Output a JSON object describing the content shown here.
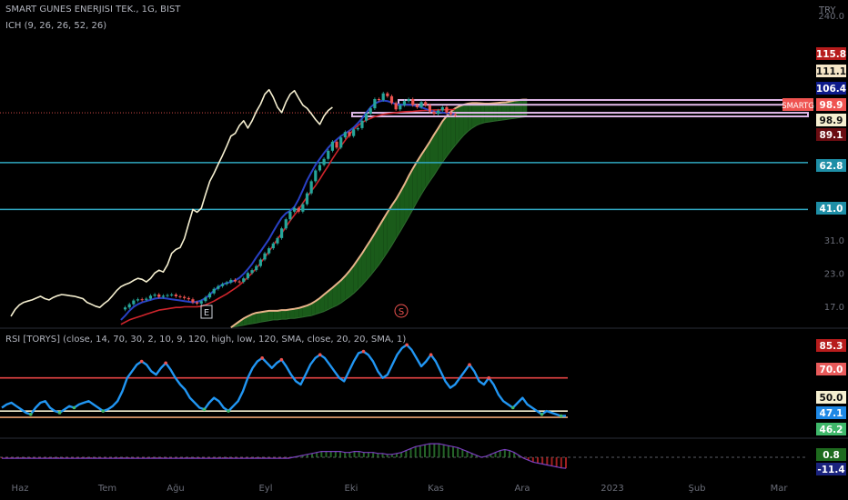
{
  "header": {
    "symbol_line": "SMART GUNES ENERJISI TEK., 1G, BIST",
    "indicator_line": "ICH (9, 26, 26, 52, 26)",
    "currency": "TRY"
  },
  "rsi_header": "RSI [TORYS] (close, 14, 70, 30, 2, 10, 9, 120, high, low, 120, SMA, close, 20, 20, SMA, 1)",
  "colors": {
    "background": "#000000",
    "price_line": "#f5efd0",
    "tenkan": "#2941c6",
    "kijun": "#d0252c",
    "senkou_a": "#e8b48a",
    "cloud_bull": "#1e6b1e",
    "horizontal_line": "#2fa7c0",
    "rsi_line": "#2196f3",
    "rsi_upper": "#e84545",
    "rsi_mid": "#f5efd0",
    "rsi_lower": "#e8a070",
    "candle_up": "#26a69a",
    "candle_down": "#ef5350"
  },
  "chart_data": [
    {
      "type": "line",
      "title": "SMART GUNES ENERJISI TEK., 1G, BIST",
      "log_scale": true,
      "x_labels": [
        "Haz",
        "Tem",
        "Ağu",
        "Eyl",
        "Eki",
        "Kas",
        "Ara",
        "2023",
        "Şub",
        "Mar"
      ],
      "y_ticks": [
        240.0,
        17.0,
        23.0,
        31.0
      ],
      "y_tick_labels": [
        "240.0",
        "17.0",
        "23.0",
        "31.0"
      ],
      "ylim": [
        14.5,
        250
      ],
      "horizontal_levels": [
        62.8,
        41.0
      ],
      "zones": [
        {
          "low": 106.4,
          "high": 111.1
        },
        {
          "low": 96.5,
          "high": 98.9
        }
      ],
      "price_labels": [
        {
          "text": "115.8",
          "value": 115.8,
          "color": "#b71c1c"
        },
        {
          "text": "111.1",
          "value": 111.1,
          "color": "#f5e6c8"
        },
        {
          "text": "106.4",
          "value": 106.4,
          "color": "#0d1a8a"
        },
        {
          "text": "98.9",
          "value": 98.9,
          "color": "#ef5350",
          "prefix": "SMARTG"
        },
        {
          "text": "98.9",
          "value": 96.0,
          "color": "#f5efd0"
        },
        {
          "text": "89.1",
          "value": 89.1,
          "color": "#6a0d12"
        },
        {
          "text": "62.8",
          "value": 62.8,
          "color": "#1e8ea6"
        },
        {
          "text": "41.0",
          "value": 41.0,
          "color": "#1e8ea6"
        }
      ],
      "markers": [
        "E",
        "S"
      ],
      "days": 130,
      "series": [
        {
          "role": "lagging",
          "values": [
            15.5,
            16.5,
            17.2,
            17.6,
            17.8,
            18.0,
            18.3,
            18.6,
            18.2,
            18.0,
            18.4,
            18.7,
            18.9,
            18.8,
            18.7,
            18.6,
            18.4,
            18.2,
            17.6,
            17.3,
            17.0,
            16.8,
            17.4,
            17.9,
            18.7,
            19.6,
            20.3,
            20.7,
            21.0,
            21.5,
            21.9,
            21.7,
            21.2,
            21.9,
            23.0,
            23.6,
            23.2,
            24.8,
            27.5,
            28.5,
            29.0,
            31.5,
            36.0,
            41.0,
            40.0,
            41.5,
            47.0,
            53.0,
            57.0,
            62.0,
            67.0,
            73.0,
            80.0,
            82.0,
            88.0,
            92.0,
            86.0,
            92.0,
            100.0,
            107.0,
            117.0,
            122.0,
            114.0,
            104.0,
            99.0,
            109.0,
            117.0,
            121.0,
            113.0,
            106.0,
            103.0,
            98.0,
            93.0,
            89.0,
            96.0,
            101.0,
            104.0
          ]
        },
        {
          "role": "candles",
          "offset_days": 26,
          "values": [
            16.5,
            16.8,
            17.3,
            17.9,
            18.1,
            18.0,
            18.2,
            18.7,
            18.9,
            18.5,
            18.7,
            18.8,
            18.9,
            18.6,
            18.5,
            18.3,
            18.1,
            17.6,
            17.4,
            17.8,
            18.4,
            19.1,
            19.9,
            20.4,
            20.8,
            21.1,
            21.6,
            21.3,
            21.2,
            21.9,
            23.0,
            23.6,
            24.5,
            26.0,
            27.5,
            28.8,
            30.1,
            31.6,
            34.5,
            37.5,
            40.2,
            41.6,
            40.2,
            43.0,
            47.5,
            53.0,
            58.5,
            61.5,
            65.0,
            70.0,
            76.0,
            72.0,
            79.0,
            83.0,
            80.0,
            85.0,
            86.0,
            92.0,
            98.0,
            103.0,
            112.0,
            111.0,
            118.0,
            115.0,
            108.0,
            102.0,
            106.0,
            110.0,
            112.0,
            106.0,
            104.0,
            109.0,
            106.0,
            100.0,
            98.0,
            101.0,
            104.0,
            99.0,
            97.5,
            96.5
          ]
        },
        {
          "role": "tenkan",
          "offset_days": 26,
          "values": [
            15.0,
            15.6,
            16.3,
            16.9,
            17.3,
            17.6,
            17.8,
            18.0,
            18.2,
            18.3,
            18.3,
            18.2,
            18.1,
            18.0,
            17.9,
            17.8,
            17.7,
            17.6,
            17.7,
            17.9,
            18.3,
            18.9,
            19.6,
            20.2,
            20.7,
            21.0,
            21.2,
            21.5,
            22.0,
            22.8,
            23.8,
            25.0,
            26.5,
            28.0,
            29.6,
            31.3,
            33.5,
            35.8,
            38.0,
            39.6,
            40.5,
            42.0,
            45.0,
            49.0,
            53.5,
            57.5,
            61.5,
            65.0,
            68.5,
            72.0,
            75.0,
            77.5,
            80.0,
            82.0,
            84.0,
            86.5,
            90.0,
            94.0,
            99.0,
            104.0,
            107.5,
            109.5,
            110.5,
            110.0,
            108.5,
            107.0,
            106.5,
            106.5,
            106.5,
            106.0,
            105.0,
            104.0,
            102.5,
            101.0,
            100.0,
            99.5,
            99.0,
            98.5,
            98.0,
            97.5
          ]
        },
        {
          "role": "kijun",
          "offset_days": 26,
          "values": [
            14.4,
            14.7,
            15.0,
            15.2,
            15.4,
            15.6,
            15.8,
            16.0,
            16.2,
            16.4,
            16.5,
            16.6,
            16.7,
            16.8,
            16.8,
            16.9,
            16.9,
            16.9,
            16.9,
            17.0,
            17.2,
            17.5,
            17.8,
            18.2,
            18.6,
            19.0,
            19.5,
            20.0,
            20.6,
            21.3,
            22.1,
            23.0,
            24.0,
            25.2,
            26.5,
            28.0,
            29.6,
            31.3,
            33.0,
            35.0,
            37.0,
            39.0,
            41.0,
            43.5,
            46.0,
            48.5,
            51.0,
            54.0,
            57.5,
            61.0,
            65.0,
            69.0,
            73.0,
            77.0,
            81.0,
            85.0,
            88.0,
            90.5,
            92.5,
            94.0,
            95.5,
            96.5,
            97.5,
            98.0,
            98.5,
            99.0,
            99.5,
            99.8,
            100.0,
            100.2,
            100.5,
            100.8,
            101.0,
            101.2,
            101.4,
            101.5,
            101.6,
            101.7,
            101.8,
            101.9
          ]
        },
        {
          "role": "senkou_a",
          "offset_days": 52,
          "values": [
            14.0,
            14.4,
            14.8,
            15.2,
            15.5,
            15.8,
            16.0,
            16.1,
            16.2,
            16.3,
            16.3,
            16.3,
            16.4,
            16.4,
            16.5,
            16.6,
            16.7,
            16.9,
            17.1,
            17.4,
            17.8,
            18.3,
            18.9,
            19.5,
            20.1,
            20.8,
            21.5,
            22.4,
            23.4,
            24.6,
            26.0,
            27.5,
            29.2,
            31.0,
            33.0,
            35.2,
            37.5,
            40.0,
            42.5,
            45.0,
            48.0,
            51.5,
            55.5,
            59.5,
            63.5,
            67.5,
            71.5,
            76.0,
            81.0,
            86.0,
            91.5,
            96.0,
            100.0,
            103.0,
            105.0,
            106.5,
            107.5,
            108.0,
            108.0,
            107.8,
            107.5,
            107.5,
            107.8,
            108.2,
            108.5,
            108.8,
            109.5,
            110.5,
            111.0,
            111.5,
            111.5
          ]
        },
        {
          "role": "senkou_b",
          "offset_days": 52,
          "values": [
            14.0,
            14.1,
            14.2,
            14.3,
            14.4,
            14.5,
            14.6,
            14.7,
            14.8,
            14.9,
            15.0,
            15.0,
            15.1,
            15.1,
            15.2,
            15.2,
            15.3,
            15.4,
            15.5,
            15.6,
            15.8,
            16.0,
            16.2,
            16.5,
            16.8,
            17.1,
            17.5,
            18.0,
            18.5,
            19.1,
            19.8,
            20.6,
            21.5,
            22.5,
            23.6,
            24.8,
            26.2,
            27.8,
            29.5,
            31.5,
            33.5,
            35.8,
            38.3,
            41.0,
            44.0,
            47.0,
            50.0,
            53.0,
            56.0,
            59.5,
            63.0,
            66.5,
            70.0,
            73.5,
            77.0,
            80.5,
            83.5,
            86.0,
            88.0,
            89.5,
            90.5,
            91.0,
            91.5,
            92.0,
            92.5,
            93.0,
            93.5,
            94.0,
            94.5,
            95.0,
            95.5
          ]
        }
      ]
    },
    {
      "type": "line",
      "title": "RSI [TORYS] (close, 14, 70, 30, 2, 10, 9, 120, high, low, 120, SMA, close, 20, 20, SMA, 1)",
      "levels": [
        70.0,
        50.0,
        46.2
      ],
      "ylim": [
        38,
        94
      ],
      "price_labels": [
        {
          "text": "85.3",
          "value": 85.3,
          "color": "#b71c1c"
        },
        {
          "text": "70.0",
          "value": 70.0,
          "color": "#e85a5a"
        },
        {
          "text": "50.0",
          "value": 50.0,
          "color": "#f5efd0"
        },
        {
          "text": "47.1",
          "value": 47.1,
          "color": "#1e88e5"
        },
        {
          "text": "46.2",
          "value": 46.2,
          "color": "#3fb86a"
        }
      ],
      "series": [
        {
          "role": "rsi",
          "values": [
            52,
            54,
            55,
            53,
            51,
            49,
            48,
            52,
            55,
            56,
            52,
            50,
            49,
            51,
            53,
            52,
            54,
            55,
            56,
            54,
            52,
            50,
            51,
            53,
            56,
            62,
            70,
            74,
            78,
            80,
            78,
            74,
            72,
            76,
            79,
            75,
            70,
            66,
            63,
            58,
            55,
            52,
            51,
            55,
            58,
            56,
            52,
            50,
            53,
            56,
            62,
            70,
            76,
            80,
            82,
            79,
            76,
            79,
            81,
            77,
            72,
            68,
            66,
            72,
            78,
            82,
            84,
            82,
            78,
            74,
            70,
            68,
            74,
            80,
            85,
            86,
            84,
            80,
            74,
            70,
            72,
            78,
            84,
            88,
            90,
            87,
            82,
            77,
            80,
            84,
            80,
            74,
            68,
            64,
            66,
            70,
            74,
            78,
            74,
            68,
            66,
            70,
            66,
            60,
            56,
            54,
            52,
            55,
            58,
            54,
            52,
            50,
            48,
            50,
            49,
            48,
            47,
            47.1
          ]
        }
      ]
    },
    {
      "type": "line",
      "title": "",
      "zero_line": true,
      "price_labels": [
        {
          "text": "0.8",
          "value": 0.8,
          "color": "#1e6b1e"
        },
        {
          "text": "-11.4",
          "value": -11.4,
          "color": "#1a237e"
        }
      ],
      "series": [
        {
          "role": "oscillator",
          "values": [
            -1,
            -1,
            -1,
            -1,
            -1,
            -1,
            -1,
            -1,
            -1,
            -1,
            -1,
            -1,
            -1,
            -1,
            -1,
            -1,
            -1,
            -1,
            -1,
            -1,
            -1,
            -1,
            -1,
            -1,
            -1,
            -1,
            -1,
            -1,
            -1,
            -1,
            -1,
            -1,
            -1,
            -1,
            -1,
            -1,
            -1,
            -1,
            -1,
            -1,
            -1,
            -1,
            -1,
            -1,
            -1,
            -1,
            -1,
            -1,
            -1,
            -1,
            -1,
            -1,
            -1,
            -1,
            -1,
            -1,
            -1,
            -1,
            -1,
            -1,
            -1,
            -1,
            0,
            1,
            2,
            3,
            4,
            5,
            6,
            6,
            6,
            6,
            6,
            5,
            5,
            6,
            6,
            5,
            5,
            5,
            4,
            4,
            3,
            3,
            4,
            5,
            7,
            9,
            11,
            12,
            13,
            14,
            14,
            14,
            13,
            12,
            11,
            10,
            8,
            6,
            4,
            2,
            0,
            1,
            3,
            5,
            7,
            8,
            7,
            5,
            2,
            -1,
            -3,
            -5,
            -6,
            -7,
            -8,
            -9,
            -10,
            -11,
            -11.4
          ]
        }
      ]
    }
  ]
}
